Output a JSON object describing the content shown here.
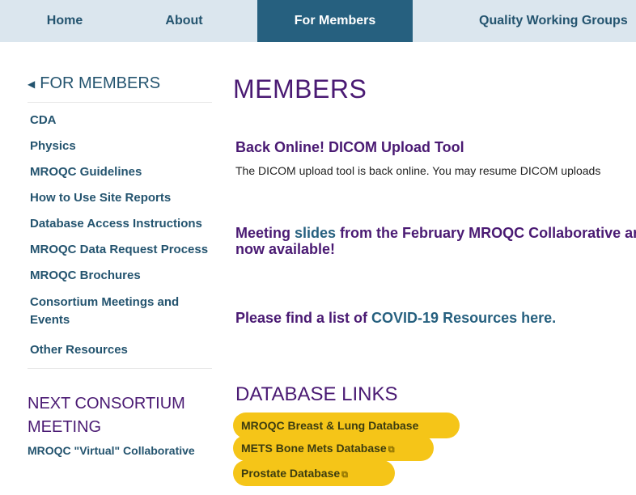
{
  "nav": {
    "home": "Home",
    "about": "About",
    "for_members": "For Members",
    "quality_groups": "Quality Working Groups"
  },
  "sidebar": {
    "heading": "FOR MEMBERS",
    "items": [
      {
        "label": "CDA"
      },
      {
        "label": "Physics"
      },
      {
        "label": "MROQC Guidelines"
      },
      {
        "label": "How to Use Site Reports"
      },
      {
        "label": "Database Access Instructions"
      },
      {
        "label": "MROQC Data Request Process"
      },
      {
        "label": "MROQC Brochures"
      },
      {
        "label": "Consortium Meetings and Events"
      },
      {
        "label": "Other Resources"
      }
    ],
    "next_heading": "NEXT CONSORTIUM MEETING",
    "next_sub": "MROQC \"Virtual\" Collaborative"
  },
  "main": {
    "title": "MEMBERS",
    "news_title": "Back Online! DICOM Upload Tool",
    "news_text": "The DICOM upload tool is back online. You may resume DICOM uploads",
    "meeting_pre": "Meeting ",
    "meeting_link": "slides",
    "meeting_post": " from the February MROQC Collaborative are now available!",
    "covid_pre": "Please find a list of ",
    "covid_link": "COVID-19 Resources here.",
    "db_title": "DATABASE LINKS",
    "db_links": [
      {
        "label": "MROQC Breast & Lung Database"
      },
      {
        "label": "METS Bone Mets Database"
      },
      {
        "label": "Prostate Database"
      }
    ]
  }
}
